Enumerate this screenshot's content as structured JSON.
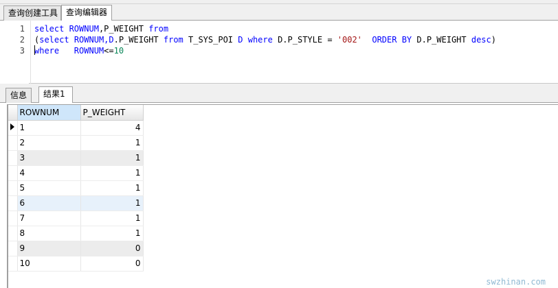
{
  "top_tabs": [
    "查询创建工具",
    "查询编辑器"
  ],
  "editor": {
    "line_numbers": [
      "1",
      "2",
      "3"
    ],
    "line1": {
      "kw1": "select",
      "t1": " ROWNUM",
      "t2": ",P_WEIGHT ",
      "kw2": "from"
    },
    "line2": {
      "p": "(",
      "kw1": "select",
      "t1": " ROWNUM",
      "t2": ",D",
      "t3": ".P_WEIGHT ",
      "kw2": "from",
      "t4": " T_SYS_POI ",
      "kw3": "D",
      "sp": " ",
      "kw4": "where",
      "t5": " D.P_STYLE = ",
      "s1": "'002'",
      "sp2": "  ",
      "kw5": "ORDER BY",
      "t6": " D.P_WEIGHT ",
      "kw6": "desc",
      "t7": ")"
    },
    "line3": {
      "kw1": "where",
      "t1": "   ROWNUM",
      "t2": "<=",
      "n1": "10"
    }
  },
  "bottom_tabs": [
    "信息",
    "结果1"
  ],
  "grid": {
    "columns": [
      "ROWNUM",
      "P_WEIGHT"
    ],
    "rows": [
      [
        "1",
        "4"
      ],
      [
        "2",
        "1"
      ],
      [
        "3",
        "1"
      ],
      [
        "4",
        "1"
      ],
      [
        "5",
        "1"
      ],
      [
        "6",
        "1"
      ],
      [
        "7",
        "1"
      ],
      [
        "8",
        "1"
      ],
      [
        "9",
        "0"
      ],
      [
        "10",
        "0"
      ]
    ]
  },
  "watermark": "swzhinan.com"
}
